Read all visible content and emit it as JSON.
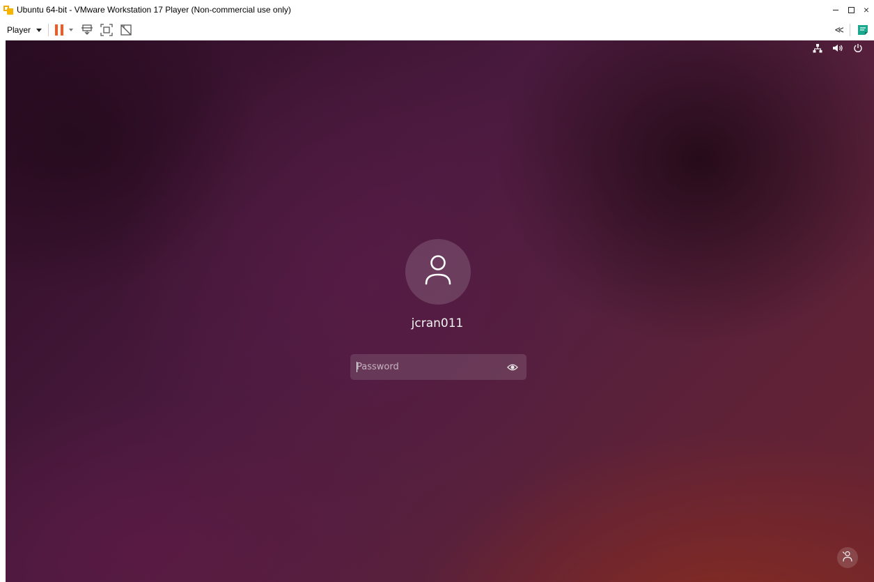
{
  "window": {
    "title": "Ubuntu 64-bit - VMware Workstation 17 Player (Non-commercial use only)",
    "app_icon": "vmware-player-icon",
    "controls": [
      "minimize-icon",
      "maximize-icon",
      "close-icon"
    ],
    "close_glyph": "×"
  },
  "toolbar": {
    "player_label": "Player",
    "icons": [
      "pause-icon",
      "send-ctrl-alt-del-icon",
      "fit-guest-icon",
      "unity-off-icon"
    ],
    "right_icons": [
      "unity-collapse-icon",
      "notes-icon"
    ],
    "collapse_glyph": "≪",
    "pause_color": "#f15a22",
    "notes_color": "#1aa98e"
  },
  "guest": {
    "tray_icons": [
      "network-icon",
      "volume-icon",
      "power-icon"
    ],
    "login": {
      "avatar_icon": "user-icon",
      "username": "jcran011",
      "password_placeholder": "Password",
      "reveal_icon": "eye-icon"
    },
    "accessibility_icon": "accessibility-icon"
  }
}
